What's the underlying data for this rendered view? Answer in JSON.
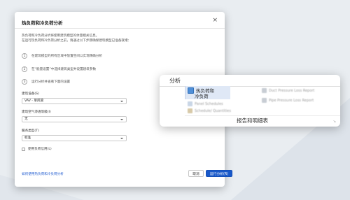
{
  "dialog": {
    "title": "热负荷和冷负荷分析",
    "close": "×",
    "intro_line1": "热负荷和冷负荷分析将使用建筑模型的体量相关信息。",
    "intro_line2": "在运行热负荷和冷负荷分析之前，请通过以下步骤确保建筑模型已准备就绪：",
    "steps": [
      {
        "num": "1",
        "text": "在建筑模型的所有区域中放置空间以实现精确分析"
      },
      {
        "num": "2",
        "text": "在“能量设置”中选择建筑类型并设置建筑参数"
      },
      {
        "num": "3",
        "text": "运行分析并查看下面的设置"
      }
    ],
    "fields": [
      {
        "label": "建筑设备(S)",
        "value": "VAV - 单风管"
      },
      {
        "label": "建筑空气渗透等级(I)",
        "value": "无"
      },
      {
        "label": "服务类型(T)",
        "value": "标准"
      }
    ],
    "checkbox_label": "使用负荷信用(L)",
    "help_link": "如何使用热负荷和冷负荷分析",
    "cancel": "取消",
    "run": "运行分析(R)"
  },
  "ribbon": {
    "tab": "分析",
    "active_item_line1": "热负荷和",
    "active_item_line2": "冷负荷",
    "faded_items": [
      "Panel Schedules",
      "Schedule/ Quantities",
      "Duct Pressure Loss Report",
      "Pipe Pressure Loss Report"
    ],
    "group_label": "报告和明细表",
    "corner": "↘"
  },
  "colors": {
    "accent": "#1858c9",
    "link": "#1f5bd0",
    "highlight": "#dfe8f6",
    "background": "#e9edf1"
  }
}
